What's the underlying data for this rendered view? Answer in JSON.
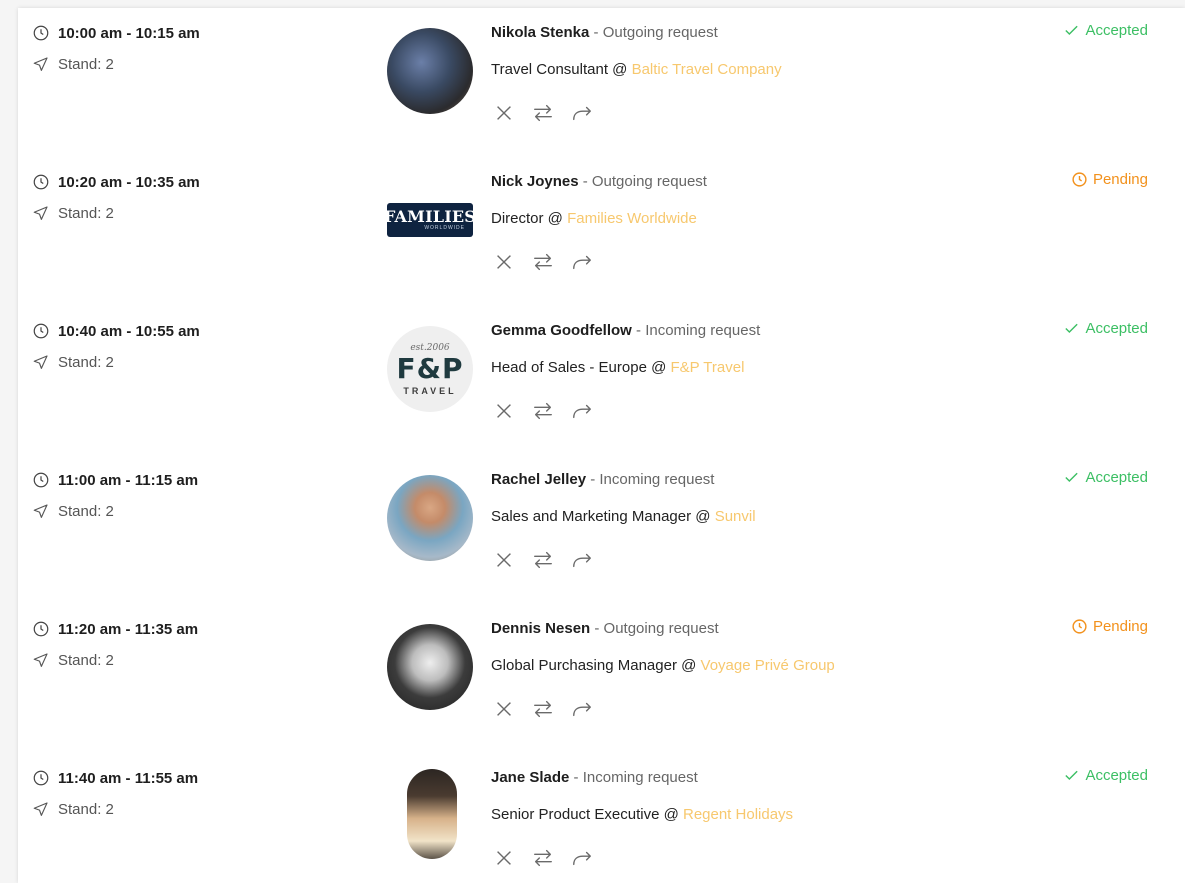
{
  "colors": {
    "accepted": "#3cbf64",
    "pending": "#f2911c",
    "company_link": "#f7c86e"
  },
  "icons": {
    "time": "clock-icon",
    "location": "location-arrow-icon",
    "decline": "close-icon",
    "reschedule": "swap-icon",
    "forward": "forward-icon",
    "accepted": "check-icon",
    "pending": "clock-icon"
  },
  "meetings": [
    {
      "time": "10:00 am - 10:15 am",
      "stand": "Stand: 2",
      "name": "Nikola Stenka",
      "request": " - Outgoing request",
      "role": "Travel Consultant @ ",
      "company": "Baltic Travel Company",
      "status": "Accepted",
      "status_type": "accepted",
      "avatar": "photo"
    },
    {
      "time": "10:20 am - 10:35 am",
      "stand": "Stand: 2",
      "name": "Nick Joynes",
      "request": " - Outgoing request",
      "role": "Director @ ",
      "company": "Families Worldwide",
      "status": "Pending",
      "status_type": "pending",
      "avatar": "families-worldwide-logo",
      "logo_text": "FAMILIES",
      "logo_subtext": "WORLDWIDE"
    },
    {
      "time": "10:40 am - 10:55 am",
      "stand": "Stand: 2",
      "name": "Gemma Goodfellow",
      "request": " - Incoming request",
      "role": "Head of Sales - Europe @ ",
      "company": "F&P Travel",
      "status": "Accepted",
      "status_type": "accepted",
      "avatar": "fp-travel-logo",
      "logo_est": "est.2006",
      "logo_text": "F&P",
      "logo_subtext": "TRAVEL"
    },
    {
      "time": "11:00 am - 11:15 am",
      "stand": "Stand: 2",
      "name": "Rachel Jelley",
      "request": " - Incoming request",
      "role": "Sales and Marketing Manager @ ",
      "company": "Sunvil",
      "status": "Accepted",
      "status_type": "accepted",
      "avatar": "photo"
    },
    {
      "time": "11:20 am - 11:35 am",
      "stand": "Stand: 2",
      "name": "Dennis Nesen",
      "request": " - Outgoing request",
      "role": "Global Purchasing Manager @ ",
      "company": "Voyage Privé Group",
      "status": "Pending",
      "status_type": "pending",
      "avatar": "photo"
    },
    {
      "time": "11:40 am - 11:55 am",
      "stand": "Stand: 2",
      "name": "Jane Slade",
      "request": " - Incoming request",
      "role": "Senior Product Executive @ ",
      "company": "Regent Holidays",
      "status": "Accepted",
      "status_type": "accepted",
      "avatar": "photo"
    }
  ]
}
